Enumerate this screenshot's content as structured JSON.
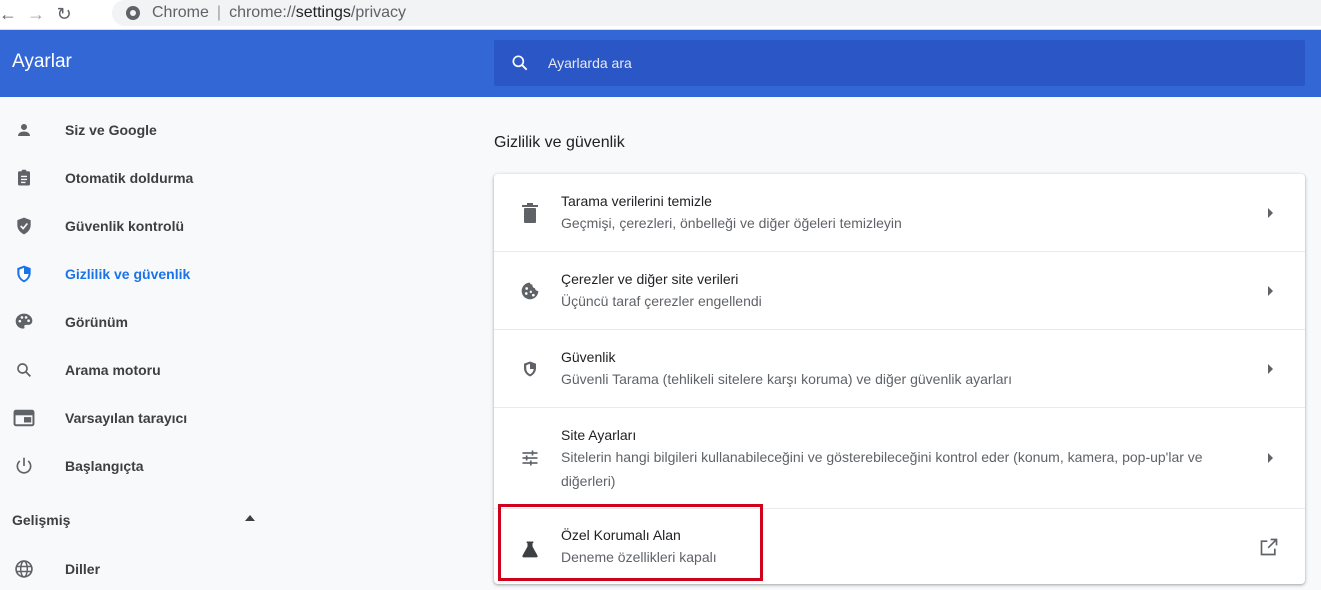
{
  "browser": {
    "back_icon": "arrow-left-icon",
    "forward_icon": "arrow-right-icon",
    "reload_icon": "reload-icon",
    "site_label": "Chrome",
    "separator": "|",
    "url_prefix": "chrome://",
    "url_host": "settings",
    "url_path": "/privacy"
  },
  "header": {
    "title": "Ayarlar",
    "search_placeholder": "Ayarlarda ara",
    "background": "#3367d6"
  },
  "sidebar": {
    "items": [
      {
        "label": "Siz ve Google",
        "icon": "person-icon"
      },
      {
        "label": "Otomatik doldurma",
        "icon": "clipboard-icon"
      },
      {
        "label": "Güvenlik kontrolü",
        "icon": "shield-check-icon"
      },
      {
        "label": "Gizlilik ve güvenlik",
        "icon": "shield-privacy-icon",
        "active": true
      },
      {
        "label": "Görünüm",
        "icon": "palette-icon"
      },
      {
        "label": "Arama motoru",
        "icon": "search-icon"
      },
      {
        "label": "Varsayılan tarayıcı",
        "icon": "browser-window-icon"
      },
      {
        "label": "Başlangıçta",
        "icon": "power-icon"
      }
    ],
    "advanced_label": "Gelişmiş",
    "advanced_items": [
      {
        "label": "Diller",
        "icon": "globe-icon"
      }
    ]
  },
  "main": {
    "section_title": "Gizlilik ve güvenlik",
    "rows": [
      {
        "title": "Tarama verilerini temizle",
        "subtitle": "Geçmişi, çerezleri, önbelleği ve diğer öğeleri temizleyin",
        "icon": "trash-icon"
      },
      {
        "title": "Çerezler ve diğer site verileri",
        "subtitle": "Üçüncü taraf çerezler engellendi",
        "icon": "cookie-icon"
      },
      {
        "title": "Güvenlik",
        "subtitle": "Güvenli Tarama (tehlikeli sitelere karşı koruma) ve diğer güvenlik ayarları",
        "icon": "shield-icon"
      },
      {
        "title": "Site Ayarları",
        "subtitle": "Sitelerin hangi bilgileri kullanabileceğini ve gösterebileceğini kontrol eder (konum, kamera, pop-up'lar ve diğerleri)",
        "icon": "tune-icon"
      },
      {
        "title": "Özel Korumalı Alan",
        "subtitle": "Deneme özellikleri kapalı",
        "icon": "flask-icon"
      }
    ]
  },
  "colors": {
    "accent": "#1a73e8",
    "highlight_box": "#d0021b"
  }
}
